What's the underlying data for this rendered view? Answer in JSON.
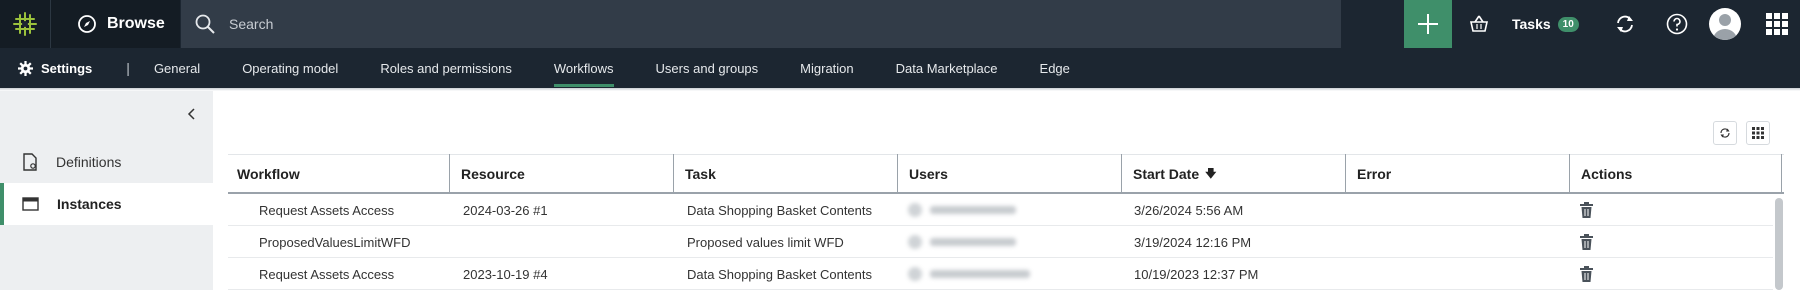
{
  "topbar": {
    "browse_label": "Browse",
    "search_placeholder": "Search",
    "tasks_label": "Tasks",
    "tasks_count": "10"
  },
  "subnav": {
    "settings_label": "Settings",
    "separator": "|",
    "tabs": [
      {
        "label": "General"
      },
      {
        "label": "Operating model"
      },
      {
        "label": "Roles and permissions"
      },
      {
        "label": "Workflows",
        "active": true
      },
      {
        "label": "Users and groups"
      },
      {
        "label": "Migration"
      },
      {
        "label": "Data Marketplace"
      },
      {
        "label": "Edge"
      }
    ]
  },
  "sidebar": {
    "items": [
      {
        "label": "Definitions",
        "icon": "definitions-icon"
      },
      {
        "label": "Instances",
        "icon": "instances-icon",
        "active": true
      }
    ]
  },
  "table": {
    "columns": [
      "Workflow",
      "Resource",
      "Task",
      "Users",
      "Start Date",
      "Error",
      "Actions"
    ],
    "sort_column": "Start Date",
    "sort_direction": "descending",
    "rows": [
      {
        "workflow": "Request Assets Access",
        "resource": "2024-03-26 #1",
        "task": "Data Shopping Basket Contents",
        "start_date": "3/26/2024 5:56 AM",
        "error": ""
      },
      {
        "workflow": "ProposedValuesLimitWFD",
        "resource": "",
        "task": "Proposed values limit WFD",
        "start_date": "3/19/2024 12:16 PM",
        "error": ""
      },
      {
        "workflow": "Request Assets Access",
        "resource": "2023-10-19 #4",
        "task": "Data Shopping Basket Contents",
        "start_date": "10/19/2023 12:37 PM",
        "error": ""
      }
    ]
  },
  "colors": {
    "topbar_bg": "#1c2631",
    "accent_green": "#3f8f6a",
    "sidebar_bg": "#edeff1"
  }
}
